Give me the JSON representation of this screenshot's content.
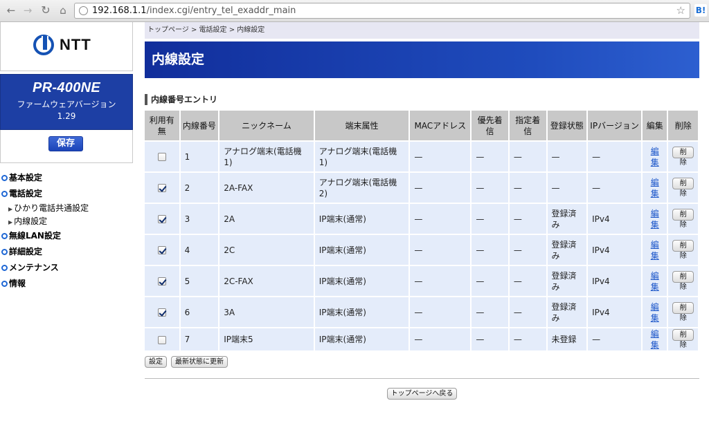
{
  "browser": {
    "url_host": "192.168.1.1",
    "url_path": "/index.cgi/entry_tel_exaddr_main",
    "extension_label": "B!"
  },
  "sidebar": {
    "logo": "NTT",
    "product": "PR-400NE",
    "fw_label": "ファームウェアバージョン",
    "fw_version": "1.29",
    "save": "保存",
    "menu": {
      "basic": "基本設定",
      "phone": "電話設定",
      "phone_sub1": "ひかり電話共通設定",
      "phone_sub2": "内線設定",
      "wlan": "無線LAN設定",
      "detail": "詳細設定",
      "maint": "メンテナンス",
      "info": "情報"
    }
  },
  "main": {
    "breadcrumb": "トップページ > 電話設定 > 内線設定",
    "title": "内線設定",
    "section": "内線番号エントリ",
    "headers": {
      "use": "利用有無",
      "num": "内線番号",
      "nick": "ニックネーム",
      "type": "端末属性",
      "mac": "MACアドレス",
      "priority": "優先着信",
      "designated": "指定着信",
      "reg": "登録状態",
      "ipver": "IPバージョン",
      "edit": "編集",
      "del": "削除"
    },
    "rows": [
      {
        "checked": false,
        "num": "1",
        "nick": "アナログ端末(電話機1)",
        "type": "アナログ端末(電話機1)",
        "mac": "—",
        "priority": "—",
        "designated": "—",
        "reg": "—",
        "ipver": "—",
        "edit": "編集",
        "del": "削除"
      },
      {
        "checked": true,
        "num": "2",
        "nick": "2A-FAX",
        "type": "アナログ端末(電話機2)",
        "mac": "—",
        "priority": "—",
        "designated": "—",
        "reg": "—",
        "ipver": "—",
        "edit": "編集",
        "del": "削除"
      },
      {
        "checked": true,
        "num": "3",
        "nick": "2A",
        "type": "IP端末(通常)",
        "mac": "—",
        "priority": "—",
        "designated": "—",
        "reg": "登録済み",
        "ipver": "IPv4",
        "edit": "編集",
        "del": "削除"
      },
      {
        "checked": true,
        "num": "4",
        "nick": "2C",
        "type": "IP端末(通常)",
        "mac": "—",
        "priority": "—",
        "designated": "—",
        "reg": "登録済み",
        "ipver": "IPv4",
        "edit": "編集",
        "del": "削除"
      },
      {
        "checked": true,
        "num": "5",
        "nick": "2C-FAX",
        "type": "IP端末(通常)",
        "mac": "—",
        "priority": "—",
        "designated": "—",
        "reg": "登録済み",
        "ipver": "IPv4",
        "edit": "編集",
        "del": "削除"
      },
      {
        "checked": true,
        "num": "6",
        "nick": "3A",
        "type": "IP端末(通常)",
        "mac": "—",
        "priority": "—",
        "designated": "—",
        "reg": "登録済み",
        "ipver": "IPv4",
        "edit": "編集",
        "del": "削除"
      },
      {
        "checked": false,
        "num": "7",
        "nick": "IP端末5",
        "type": "IP端末(通常)",
        "mac": "—",
        "priority": "—",
        "designated": "—",
        "reg": "未登録",
        "ipver": "—",
        "edit": "編集",
        "del": "削除"
      }
    ],
    "buttons": {
      "apply": "設定",
      "refresh": "最新状態に更新",
      "top": "トップページへ戻る"
    }
  }
}
